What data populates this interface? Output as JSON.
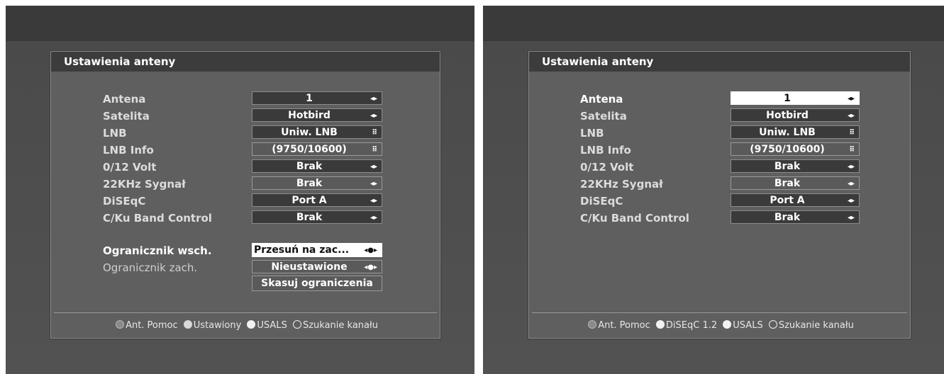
{
  "left": {
    "title": "Ustawienia anteny",
    "rows": [
      {
        "label": "Antena",
        "value": "1",
        "icon": "◂▸"
      },
      {
        "label": "Satelita",
        "value": "Hotbird",
        "icon": "◂▸"
      },
      {
        "label": "LNB",
        "value": "Uniw. LNB",
        "icon": "⠿"
      },
      {
        "label": "LNB Info",
        "value": "(9750/10600)",
        "icon": "⠿"
      },
      {
        "label": "0/12 Volt",
        "value": "Brak",
        "icon": "◂▸"
      },
      {
        "label": "22KHz Sygnał",
        "value": "Brak",
        "icon": "◂▸"
      },
      {
        "label": "DiSEqC",
        "value": "Port A",
        "icon": "◂▸"
      },
      {
        "label": "C/Ku Band Control",
        "value": "Brak",
        "icon": "◂▸"
      }
    ],
    "limit_east": {
      "label": "Ogranicznik wsch.",
      "value": "Przesuń na zac...",
      "icon": "◂●▸"
    },
    "limit_west": {
      "label": "Ogranicznik zach.",
      "value": "Nieustawione",
      "icon": "◂●▸"
    },
    "clear_button": "Skasuj ograniczenia",
    "footer": {
      "a": "Ant. Pomoc",
      "b": "Ustawiony",
      "c": "USALS",
      "d": "Szukanie kanału"
    }
  },
  "right": {
    "title": "Ustawienia anteny",
    "rows": [
      {
        "label": "Antena",
        "value": "1",
        "icon": "◂▸"
      },
      {
        "label": "Satelita",
        "value": "Hotbird",
        "icon": "◂▸"
      },
      {
        "label": "LNB",
        "value": "Uniw. LNB",
        "icon": "⠿"
      },
      {
        "label": "LNB Info",
        "value": "(9750/10600)",
        "icon": "⠿"
      },
      {
        "label": "0/12 Volt",
        "value": "Brak",
        "icon": "◂▸"
      },
      {
        "label": "22KHz Sygnał",
        "value": "Brak",
        "icon": "◂▸"
      },
      {
        "label": "DiSEqC",
        "value": "Port A",
        "icon": "◂▸"
      },
      {
        "label": "C/Ku Band Control",
        "value": "Brak",
        "icon": "◂▸"
      }
    ],
    "footer": {
      "a": "Ant. Pomoc",
      "b": "DiSEqC 1.2",
      "c": "USALS",
      "d": "Szukanie kanału"
    }
  }
}
